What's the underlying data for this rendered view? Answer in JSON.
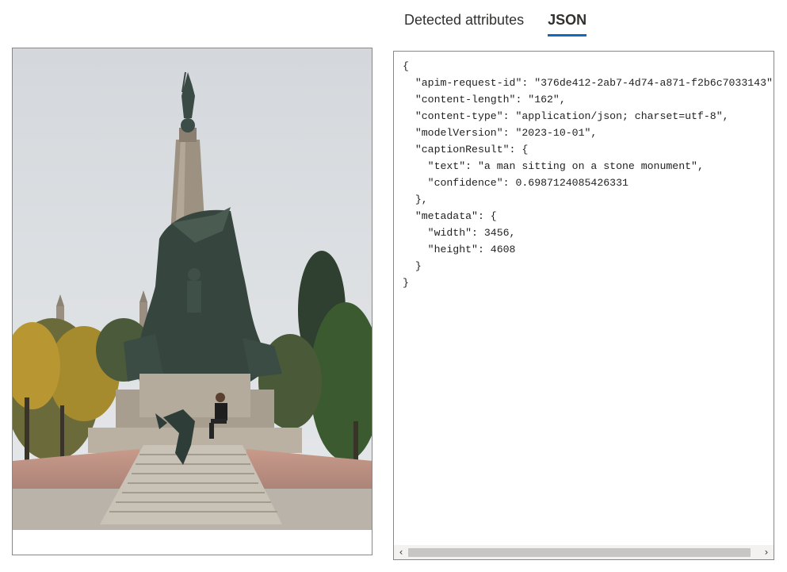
{
  "tabs": [
    {
      "label": "Detected attributes",
      "active": false
    },
    {
      "label": "JSON",
      "active": true
    }
  ],
  "json_lines": [
    "{",
    "  \"apim-request-id\": \"376de412-2ab7-4d74-a871-f2b6c7033143\",",
    "  \"content-length\": \"162\",",
    "  \"content-type\": \"application/json; charset=utf-8\",",
    "  \"modelVersion\": \"2023-10-01\",",
    "  \"captionResult\": {",
    "    \"text\": \"a man sitting on a stone monument\",",
    "    \"confidence\": 0.6987124085426331",
    "  },",
    "  \"metadata\": {",
    "    \"width\": 3456,",
    "    \"height\": 4608",
    "  }",
    "}"
  ],
  "scrollbar": {
    "left_icon": "chevron-left-icon",
    "right_icon": "chevron-right-icon",
    "left_glyph": "‹",
    "right_glyph": "›"
  },
  "photo": {
    "description_icon": "monument-photo"
  }
}
